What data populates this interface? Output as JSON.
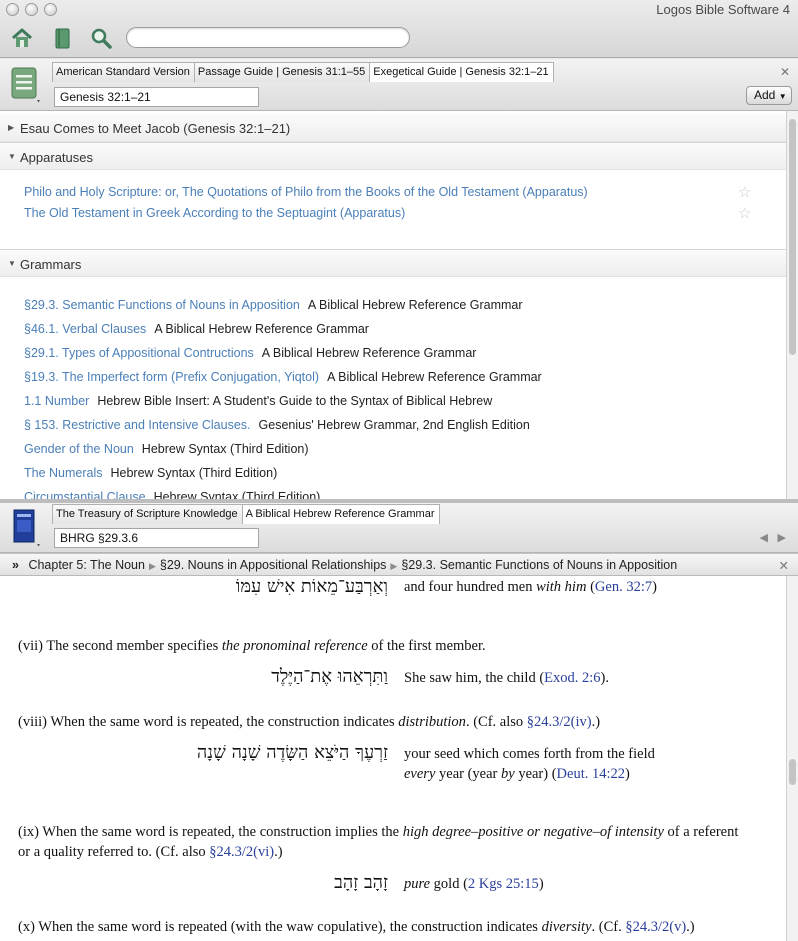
{
  "app": {
    "title": "Logos Bible Software 4"
  },
  "toolbar": {
    "search_placeholder": ""
  },
  "top_panel": {
    "tabs": [
      {
        "label": "American Standard Version"
      },
      {
        "label": "Passage Guide | Genesis 31:1–55"
      },
      {
        "label": "Exegetical Guide | Genesis 32:1–21"
      }
    ],
    "reference": "Genesis 32:1–21",
    "add_label": "Add",
    "collapsed_section": "Esau Comes to Meet Jacob (Genesis 32:1–21)",
    "apparatuses": {
      "title": "Apparatuses",
      "items": [
        "Philo and Holy Scripture: or, The Quotations of Philo from the Books of the Old Testament (Apparatus)",
        "The Old Testament in Greek According to the Septuagint (Apparatus)"
      ]
    },
    "grammars": {
      "title": "Grammars",
      "items": [
        {
          "link": "§29.3. Semantic Functions of Nouns in Apposition",
          "book": "A Biblical Hebrew Reference Grammar"
        },
        {
          "link": "§46.1. Verbal Clauses",
          "book": "A Biblical Hebrew Reference Grammar"
        },
        {
          "link": "§29.1. Types of Appositional Contructions",
          "book": "A Biblical Hebrew Reference Grammar"
        },
        {
          "link": "§19.3. The Imperfect form (Prefix Conjugation, Yiqtol)",
          "book": "A Biblical Hebrew Reference Grammar"
        },
        {
          "link": "1.1 Number",
          "book": "Hebrew Bible Insert: A Student's Guide to the Syntax of Biblical Hebrew"
        },
        {
          "link": "§ 153. Restrictive and Intensive Clauses.",
          "book": "Gesenius' Hebrew Grammar, 2nd English Edition"
        },
        {
          "link": "Gender of the Noun",
          "book": "Hebrew Syntax (Third Edition)"
        },
        {
          "link": "The Numerals",
          "book": "Hebrew Syntax (Third Edition)"
        },
        {
          "link": "Circumstantial Clause",
          "book": "Hebrew Syntax (Third Edition)"
        }
      ]
    }
  },
  "bottom_panel": {
    "tabs": [
      {
        "label": "The Treasury of Scripture Knowledge"
      },
      {
        "label": "A Biblical Hebrew Reference Grammar"
      }
    ],
    "reference": "BHRG §29.3.6",
    "breadcrumb": [
      "Chapter 5: The Noun",
      "§29. Nouns in Appositional Relationships",
      "§29.3. Semantic Functions of Nouns in Apposition"
    ],
    "doc": {
      "ex1": {
        "hebrew": "וְאַרְבַּע־מֵאוֹת אִישׁ עִמּוֹ",
        "gloss_a": "and four hundred men ",
        "gloss_em": "with him",
        "gloss_b": " (",
        "ref": "Gen. 32:7",
        "gloss_c": ")"
      },
      "p7": {
        "a": "(vii) The second member specifies ",
        "em": "the pronominal reference",
        "b": " of the first member."
      },
      "ex2": {
        "hebrew": "וַתִּרְאֵהוּ אֶת־הַיֶּלֶד",
        "gloss_a": "She saw him, the child (",
        "ref": "Exod. 2:6",
        "gloss_c": ")."
      },
      "p8": {
        "a": "(viii) When the same word is repeated, the construction indicates ",
        "em": "distribution",
        "b": ". (Cf. also ",
        "ref": "§24.3/2(iv)",
        "c": ".)"
      },
      "ex3": {
        "hebrew": "זַרְעֶךָ הַיֹּצֵא הַשָּׂדֶה שָׁנָה שָׁנָה",
        "gloss_a": "your seed which comes forth from the field ",
        "gloss_em": "every",
        "gloss_b": " year (year ",
        "gloss_em2": "by",
        "gloss_b2": " year) (",
        "ref": "Deut. 14:22",
        "gloss_c": ")"
      },
      "p9": {
        "a": "(ix) When the same word is repeated, the construction implies the ",
        "em": "high degree–positive or negative–of intensity",
        "b": " of a referent or a quality referred to. (Cf. also ",
        "ref": "§24.3/2(vi)",
        "c": ".)"
      },
      "ex4": {
        "hebrew": "זָהָב זָהָב",
        "gloss_em": "pure",
        "gloss_a": " gold (",
        "ref": "2 Kgs 25:15",
        "gloss_c": ")"
      },
      "p10": {
        "a": "(x) When the same word is repeated (with the waw copulative), the construction indicates ",
        "em": "diversity",
        "b": ". (Cf. ",
        "ref": "§24.3/2(v)",
        "c": ".)"
      }
    }
  },
  "colors": {
    "link": "#4a7fb8",
    "ref": "#2a3f9a",
    "accent": "#6b9a6b"
  }
}
